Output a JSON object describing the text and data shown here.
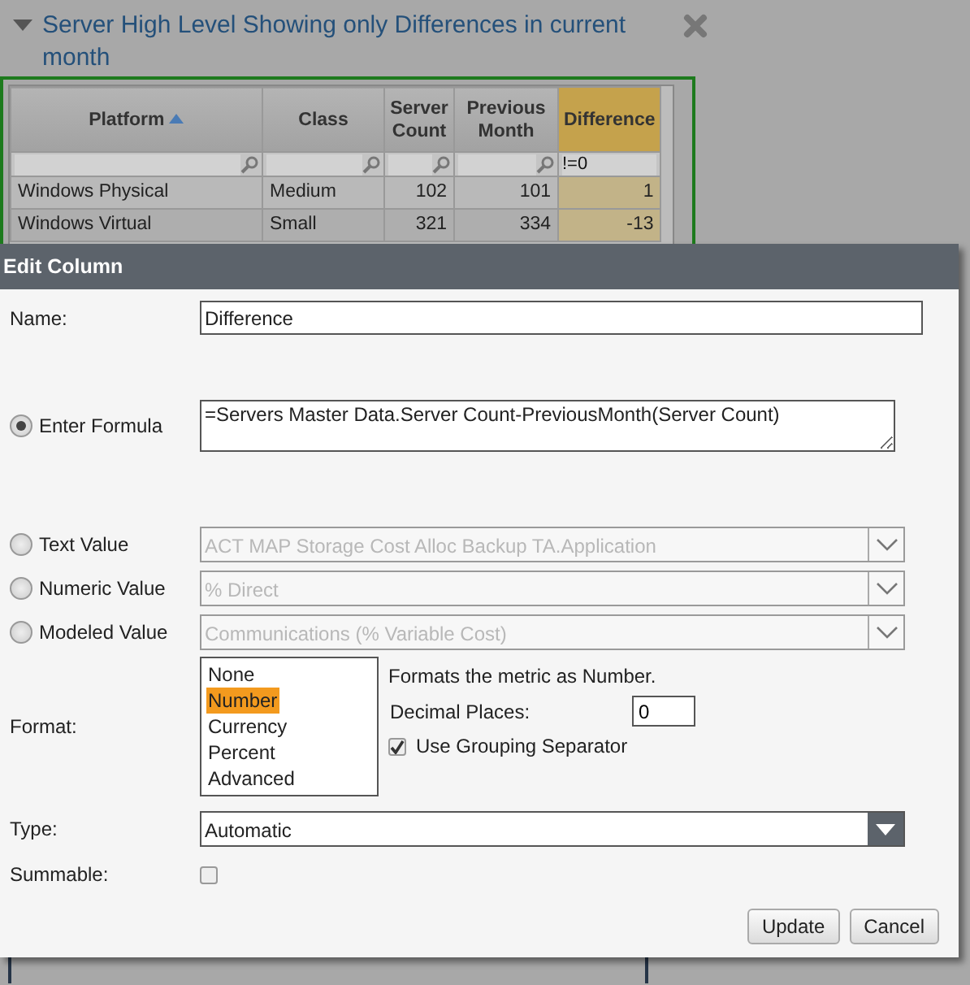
{
  "panel": {
    "title": "Server High Level Showing only Differences in current month",
    "expanded": true,
    "table": {
      "columns": [
        {
          "label": "Platform",
          "sorted": true
        },
        {
          "label": "Class"
        },
        {
          "label": "Server Count"
        },
        {
          "label": "Previous Month"
        },
        {
          "label": "Difference",
          "highlighted": true,
          "filter": "!=0"
        }
      ],
      "rows": [
        [
          "Windows Physical",
          "Medium",
          "102",
          "101",
          "1"
        ],
        [
          "Windows Virtual",
          "Small",
          "321",
          "334",
          "-13"
        ]
      ]
    }
  },
  "dialog": {
    "title": "Edit Column",
    "name": {
      "label": "Name:",
      "value": "Difference"
    },
    "sources": [
      {
        "kind": "formula",
        "label": "Enter Formula",
        "selected": true,
        "value": "=Servers Master Data.Server Count-PreviousMonth(Server Count)"
      },
      {
        "kind": "select",
        "label": "Text Value",
        "selected": false,
        "disabled": true,
        "value": "ACT MAP Storage Cost Alloc Backup TA.Application"
      },
      {
        "kind": "select",
        "label": "Numeric Value",
        "selected": false,
        "disabled": true,
        "value": "% Direct"
      },
      {
        "kind": "select",
        "label": "Modeled Value",
        "selected": false,
        "disabled": true,
        "value": "Communications (% Variable Cost)"
      }
    ],
    "format": {
      "label": "Format:",
      "options": [
        {
          "label": "None",
          "selected": false
        },
        {
          "label": "Number",
          "selected": true
        },
        {
          "label": "Currency",
          "selected": false
        },
        {
          "label": "Percent",
          "selected": false
        },
        {
          "label": "Advanced",
          "selected": false
        }
      ],
      "description": "Formats the metric as Number.",
      "decimal_places": {
        "label": "Decimal Places:",
        "value": "0"
      },
      "grouping": {
        "label": "Use Grouping Separator",
        "checked": true
      }
    },
    "type": {
      "label": "Type:",
      "value": "Automatic"
    },
    "summable": {
      "label": "Summable:",
      "checked": false
    },
    "buttons": [
      "Update",
      "Cancel"
    ]
  }
}
